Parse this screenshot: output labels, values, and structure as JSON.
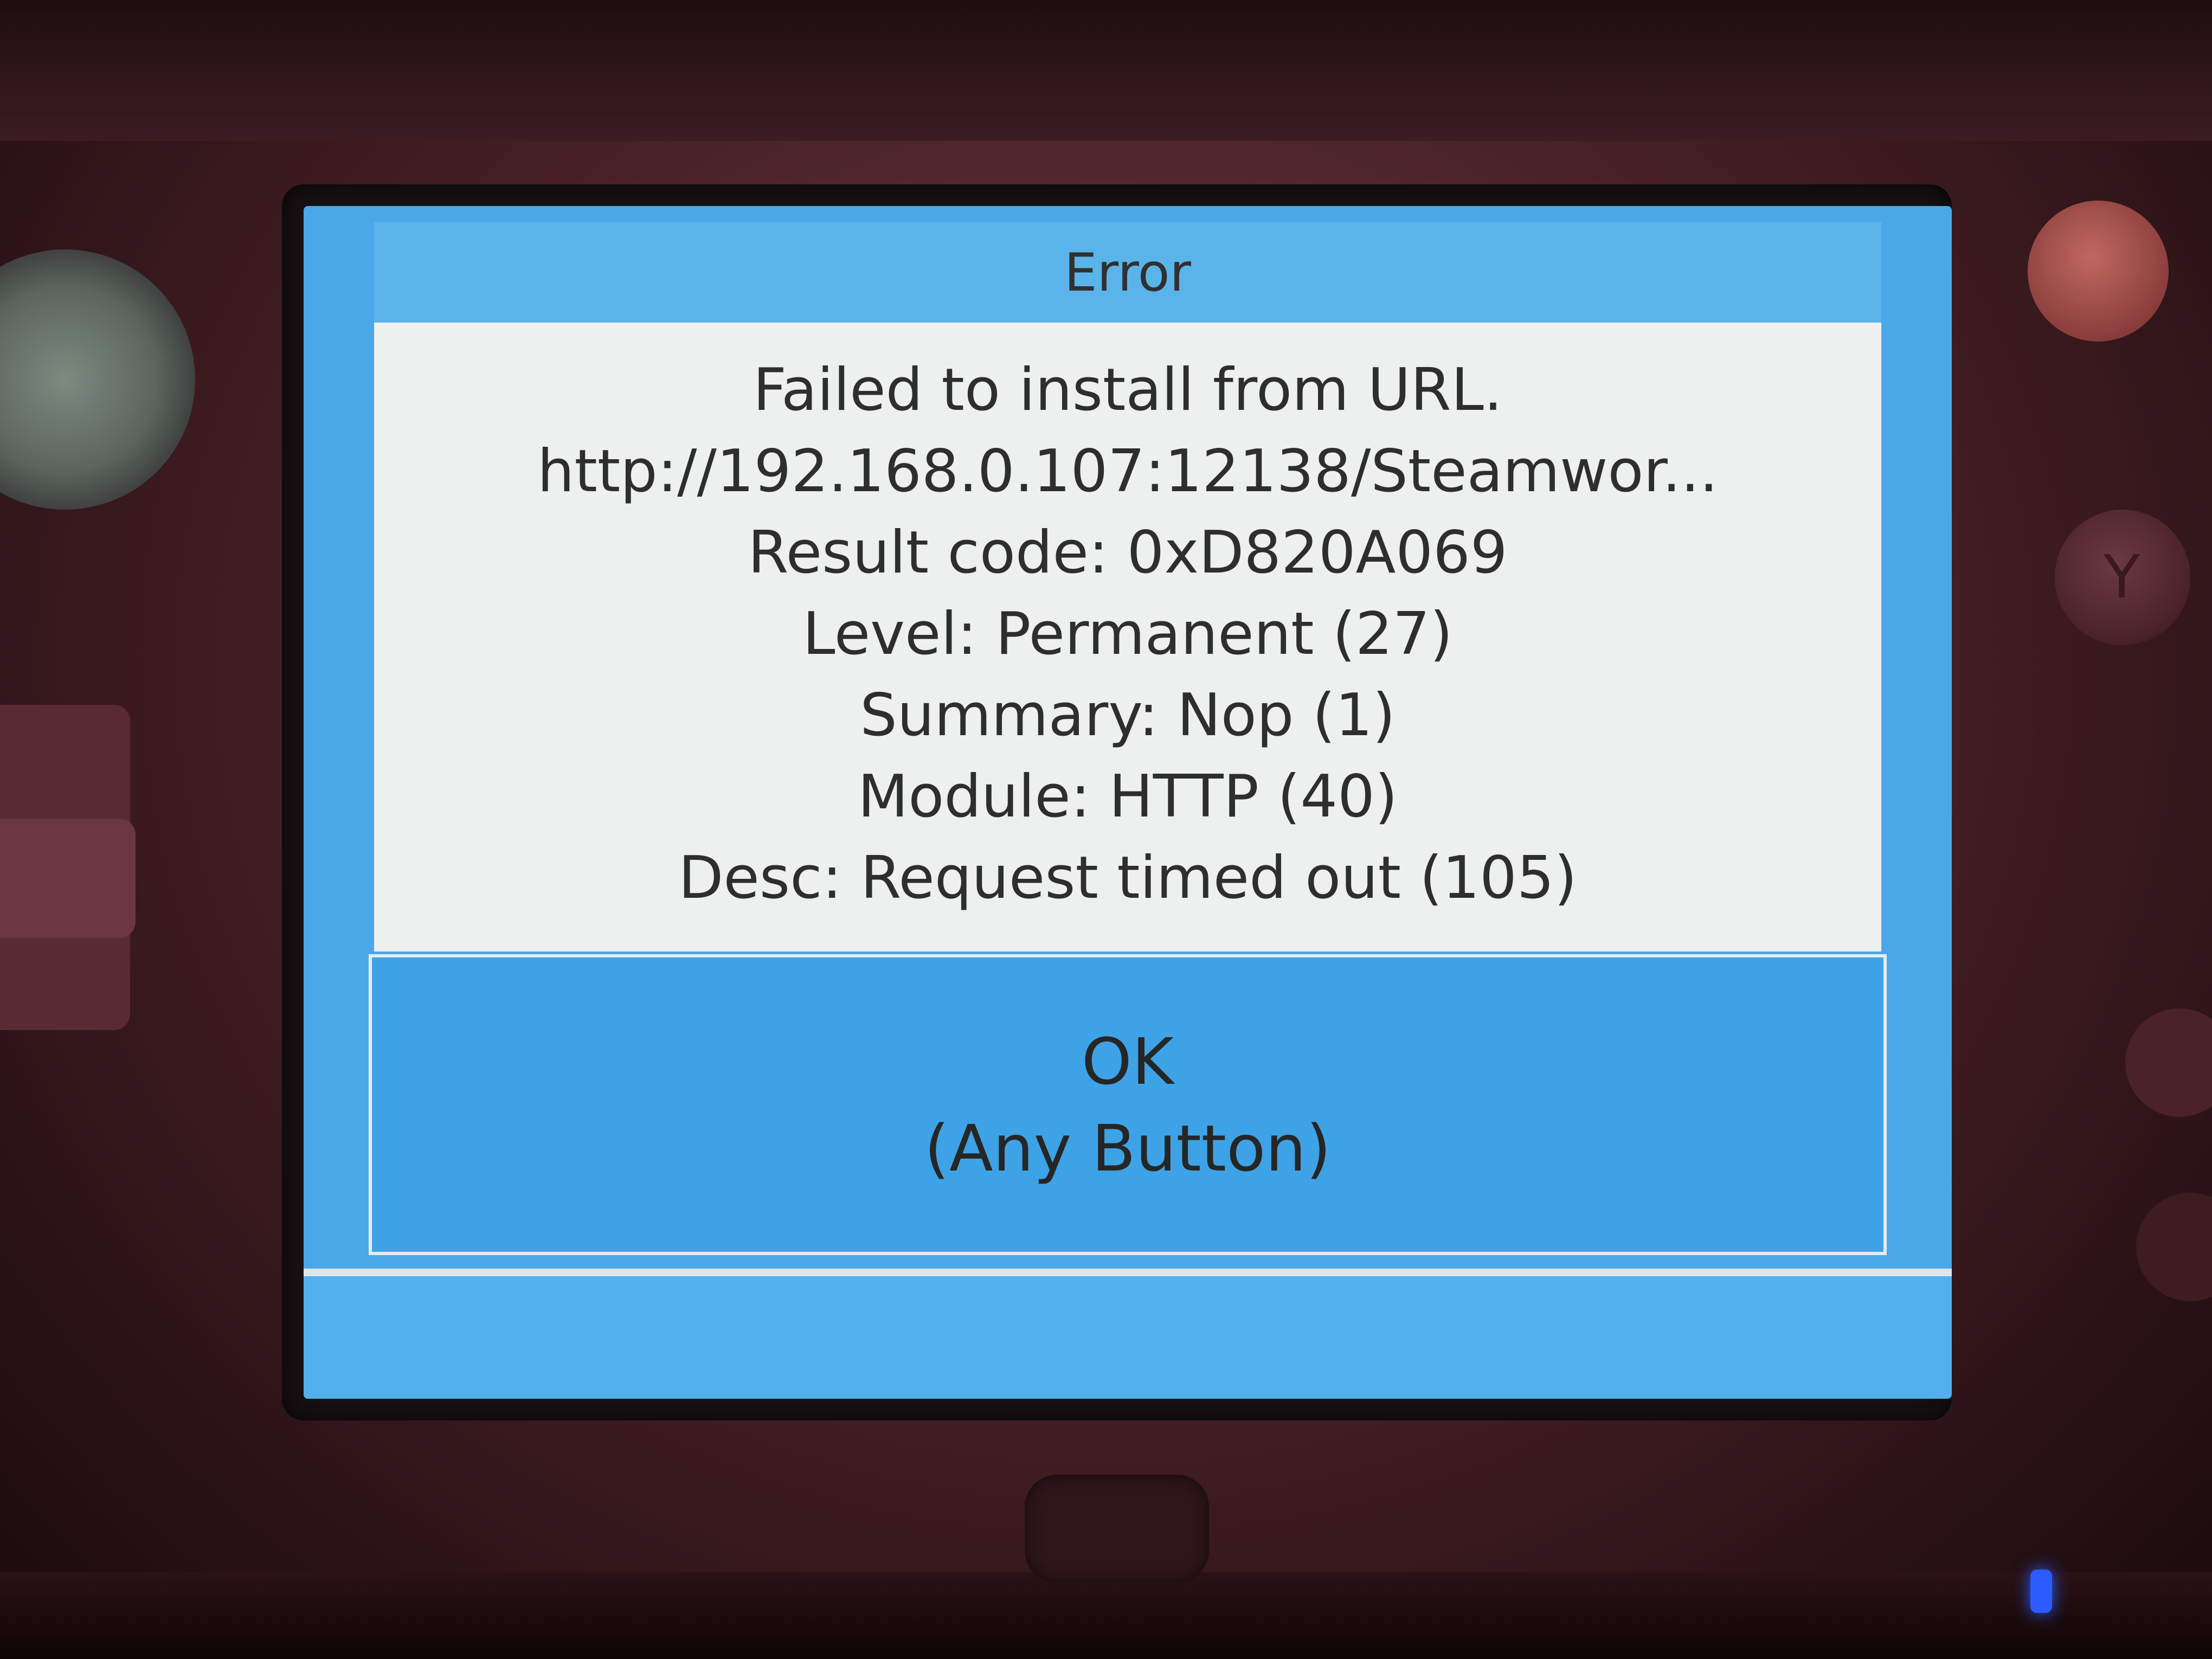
{
  "dialog": {
    "title": "Error",
    "lines": [
      "Failed to install from URL.",
      "http://192.168.0.107:12138/Steamwor...",
      "Result code: 0xD820A069",
      "Level: Permanent (27)",
      "Summary: Nop (1)",
      "Module: HTTP (40)",
      "Desc: Request timed out (105)"
    ],
    "ok_label": "OK",
    "ok_sub": "(Any Button)"
  },
  "device": {
    "y_button_label": "Y"
  },
  "colors": {
    "title_bar": "#5ab4ea",
    "message_bg": "#eef0f0",
    "ok_button": "#3ea3e6",
    "console_shell": "#4a2228",
    "power_led": "#2b5cff"
  }
}
